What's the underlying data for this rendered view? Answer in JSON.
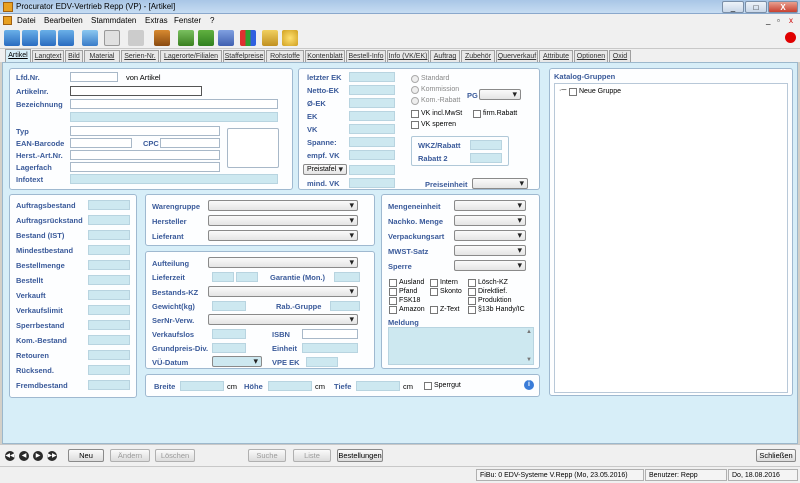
{
  "window": {
    "title": "Procurator EDV-Vertrieb Repp (VP) - [Artikel]",
    "close_glyph": "X",
    "min_glyph": "_",
    "max_glyph": "□"
  },
  "menu": [
    "Datei",
    "Bearbeiten",
    "Stammdaten",
    "Extras",
    "Fenster",
    "?"
  ],
  "mdi_controls": [
    "_",
    "▫",
    "x"
  ],
  "tabs": [
    "Artikel",
    "Langtext",
    "Bild",
    "Material",
    "Serien-Nr.",
    "Lagerorte/Filialen",
    "Staffelpreise",
    "Rohstoffe",
    "Kontenblatt",
    "Bestell-Info",
    "Info (VK/EK)",
    "Auftrag",
    "Zubehör",
    "Querverkauf",
    "Attribute",
    "Optionen",
    "Oxid"
  ],
  "top_left": {
    "lfd_nr": "Lfd.Nr.",
    "von_artikel": "von Artikel",
    "artikelnr": "Artikelnr.",
    "bezeichnung": "Bezeichnung",
    "typ": "Typ",
    "ean": "EAN-Barcode",
    "cpc": "CPC",
    "herst": "Herst.-Art.Nr.",
    "lagerfach": "Lagerfach",
    "infotext": "Infotext"
  },
  "prices": {
    "labels": [
      "letzter EK",
      "Netto-EK",
      "Ø-EK",
      "EK",
      "VK",
      "Spanne:",
      "empf. VK"
    ],
    "preistafel": "Preistafel",
    "mind_vk": "mind. VK",
    "standard": "Standard",
    "kommission": "Kommission",
    "kom_rabatt": "Kom.-Rabatt",
    "pg": "PG",
    "vk_incl": "VK incl.MwSt",
    "firm_rabatt": "firm.Rabatt",
    "vk_sperren": "VK sperren",
    "wkz": "WKZ/Rabatt",
    "rabatt2": "Rabatt 2",
    "preiseinheit": "Preiseinheit"
  },
  "katalog": {
    "title": "Katalog-Gruppen",
    "node": "Neue Gruppe"
  },
  "stock_labels": [
    "Auftragsbestand",
    "Auftragsrückstand",
    "Bestand (IST)",
    "Mindestbestand",
    "Bestellmenge",
    "Bestellt",
    "Verkauft",
    "Verkaufslimit",
    "Sperrbestand",
    "Kom.-Bestand",
    "Retouren",
    "Rücksend.",
    "Fremdbestand"
  ],
  "middle": {
    "warengruppe": "Warengruppe",
    "hersteller": "Hersteller",
    "lieferant": "Lieferant",
    "aufteilung": "Aufteilung",
    "lieferzeit": "Lieferzeit",
    "garantie": "Garantie (Mon.)",
    "bestands_kz": "Bestands-KZ",
    "gewicht": "Gewicht(kg)",
    "rab_gruppe": "Rab.-Gruppe",
    "sernr": "SerNr-Verw.",
    "verkaufslos": "Verkaufslos",
    "isbn": "ISBN",
    "grundpreis": "Grundpreis-Div.",
    "einheit": "Einheit",
    "vu_datum": "VÜ-Datum",
    "vpe_ek": "VPE EK"
  },
  "right_mid": {
    "mengeneinheit": "Mengeneinheit",
    "nachko": "Nachko. Menge",
    "verpackungsart": "Verpackungsart",
    "mwst": "MWST-Satz",
    "sperre": "Sperre",
    "checks_col1": [
      "Ausland",
      "Pfand",
      "FSK18",
      "Amazon"
    ],
    "checks_col2": [
      "Intern",
      "Skonto",
      "",
      "Z-Text"
    ],
    "checks_col3": [
      "Lösch-KZ",
      "Direktlief.",
      "Produktion",
      "§13b Handy/IC"
    ],
    "meldung": "Meldung"
  },
  "dims": {
    "breite": "Breite",
    "hoehe": "Höhe",
    "tiefe": "Tiefe",
    "cm": "cm",
    "sperrgut": "Sperrgut"
  },
  "buttons": {
    "neu": "Neu",
    "andern": "Ändern",
    "loschen": "Löschen",
    "suche": "Suche",
    "liste": "Liste",
    "bestellungen": "Bestellungen",
    "schliessen": "Schließen"
  },
  "status": {
    "fibu": "FiBu: 0 EDV-Systeme V.Repp (Mo, 23.05.2016)",
    "benutzer": "Benutzer: Repp",
    "datum": "Do, 18.08.2016"
  }
}
